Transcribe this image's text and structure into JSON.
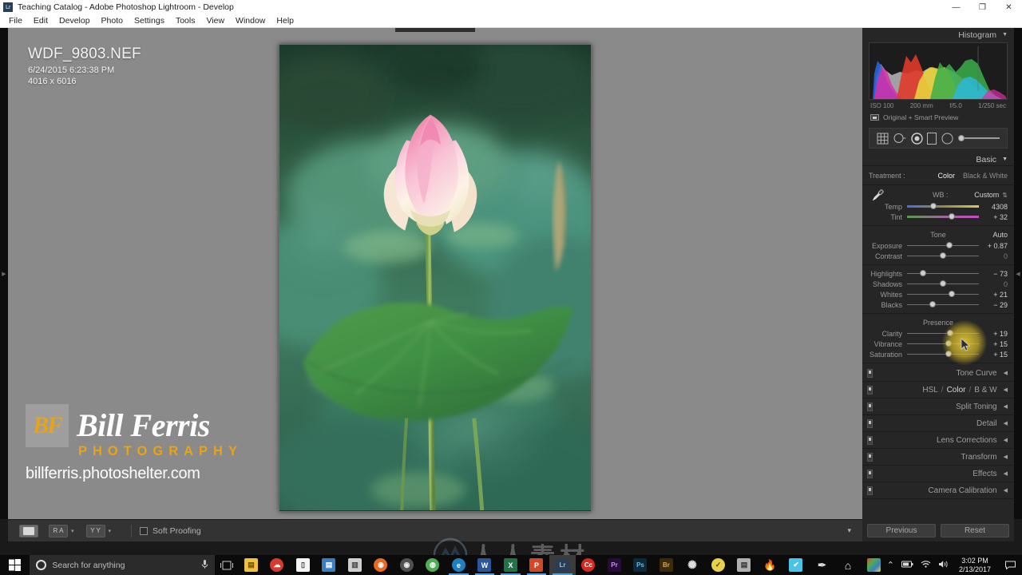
{
  "window": {
    "app_badge": "Lr",
    "title": "Teaching Catalog - Adobe Photoshop Lightroom - Develop",
    "minimize": "—",
    "maximize": "❐",
    "close": "✕"
  },
  "menubar": {
    "items": [
      "File",
      "Edit",
      "Develop",
      "Photo",
      "Settings",
      "Tools",
      "View",
      "Window",
      "Help"
    ]
  },
  "photo_info": {
    "filename": "WDF_9803.NEF",
    "capture_datetime": "6/24/2015 6:23:38 PM",
    "dimensions": "4016 x 6016"
  },
  "watermark": {
    "monogram": "BF",
    "name": "Bill Ferris",
    "tagline": "PHOTOGRAPHY",
    "url": "billferris.photoshelter.com",
    "gold": "#e8a317"
  },
  "toolbar": {
    "view_loupe": "▭",
    "view_compare": "R A",
    "view_survey": "Y Y",
    "soft_proofing_label": "Soft Proofing",
    "expand_caret": "▾"
  },
  "right_panel": {
    "histogram": {
      "title": "Histogram",
      "collapse": "▼",
      "iso": "ISO 100",
      "focal_length": "200 mm",
      "aperture": "f/5.0",
      "shutter": "1/250 sec",
      "preview_status": "Original + Smart Preview"
    },
    "tools": [
      "crop-overlay",
      "spot-removal",
      "red-eye",
      "graduated-filter",
      "radial-filter",
      "adjustment-brush"
    ],
    "basic": {
      "title": "Basic",
      "collapse": "▼",
      "treatment_label": "Treatment :",
      "treatment_color": "Color",
      "treatment_bw": "Black & White",
      "wb_label": "WB :",
      "wb_value": "Custom",
      "wb_dropdown": "⇅",
      "white_balance": [
        {
          "label": "Temp",
          "value": "4308",
          "pos": 37
        },
        {
          "label": "Tint",
          "value": "+ 32",
          "pos": 62
        }
      ],
      "tone_title": "Tone",
      "auto_label": "Auto",
      "tone": [
        {
          "label": "Exposure",
          "value": "+ 0.87",
          "pos": 59,
          "zero": false
        },
        {
          "label": "Contrast",
          "value": "0",
          "pos": 50,
          "zero": true
        }
      ],
      "tone2": [
        {
          "label": "Highlights",
          "value": "− 73",
          "pos": 22,
          "zero": false
        },
        {
          "label": "Shadows",
          "value": "0",
          "pos": 50,
          "zero": true
        },
        {
          "label": "Whites",
          "value": "+ 21",
          "pos": 62,
          "zero": false
        },
        {
          "label": "Blacks",
          "value": "− 29",
          "pos": 36,
          "zero": false
        }
      ],
      "presence_title": "Presence",
      "presence": [
        {
          "label": "Clarity",
          "value": "+ 19",
          "pos": 60,
          "zero": false
        },
        {
          "label": "Vibrance",
          "value": "+ 15",
          "pos": 58,
          "zero": false
        },
        {
          "label": "Saturation",
          "value": "+ 15",
          "pos": 58,
          "zero": false
        }
      ]
    },
    "panels": [
      {
        "label": "Tone Curve",
        "tri": "◀"
      },
      {
        "label": "HSL",
        "label2": "Color",
        "label3": "B & W",
        "sep": "/",
        "tri": "◀"
      },
      {
        "label": "Split Toning",
        "tri": "◀"
      },
      {
        "label": "Detail",
        "tri": "◀"
      },
      {
        "label": "Lens Corrections",
        "tri": "◀"
      },
      {
        "label": "Transform",
        "tri": "◀"
      },
      {
        "label": "Effects",
        "tri": "◀"
      },
      {
        "label": "Camera Calibration",
        "tri": "◀"
      }
    ],
    "footer": {
      "previous": "Previous",
      "reset": "Reset"
    }
  },
  "overlay_watermark": {
    "text": "人人素材"
  },
  "taskbar": {
    "search_placeholder": "Search for anything",
    "mic_icon": "🎤",
    "apps": [
      {
        "name": "file-explorer",
        "glyph": "📁",
        "bg": "#f0c040",
        "color": "#6b4c00"
      },
      {
        "name": "cloud-app",
        "glyph": "☁",
        "bg": "#d63b2f",
        "color": "#fff"
      },
      {
        "name": "store-app",
        "glyph": "🛍",
        "bg": "#f5f5f5",
        "color": "#333"
      },
      {
        "name": "display-app",
        "glyph": "🖥",
        "bg": "#3a7fc1",
        "color": "#fff"
      },
      {
        "name": "recycle-bin",
        "glyph": "🗑",
        "bg": "#cfcfcf",
        "color": "#444"
      },
      {
        "name": "firefox",
        "glyph": "🦊",
        "bg": "#e86a1e",
        "color": "#fff"
      },
      {
        "name": "camera-app",
        "glyph": "◉",
        "bg": "#505050",
        "color": "#eee"
      },
      {
        "name": "chrome",
        "glyph": "◍",
        "bg": "#4caf50",
        "color": "#fff"
      },
      {
        "name": "edge",
        "glyph": "e",
        "bg": "#1e7fc1",
        "color": "#fff"
      },
      {
        "name": "word",
        "glyph": "W",
        "bg": "#2b579a",
        "color": "#fff"
      },
      {
        "name": "excel",
        "glyph": "X",
        "bg": "#217346",
        "color": "#fff"
      },
      {
        "name": "powerpoint",
        "glyph": "P",
        "bg": "#d24726",
        "color": "#fff"
      },
      {
        "name": "lightroom",
        "glyph": "Lr",
        "bg": "#2a3d52",
        "color": "#8fc1e3"
      },
      {
        "name": "adobe-cc",
        "glyph": "Cc",
        "bg": "#d42b1e",
        "color": "#fff"
      },
      {
        "name": "premiere",
        "glyph": "Pr",
        "bg": "#2a0a3d",
        "color": "#c39bd8"
      },
      {
        "name": "photoshop",
        "glyph": "Ps",
        "bg": "#0a2a3d",
        "color": "#6fb8e0"
      },
      {
        "name": "bridge",
        "glyph": "Br",
        "bg": "#3d2a0a",
        "color": "#d8a95a"
      },
      {
        "name": "spiral-app",
        "glyph": "✺",
        "bg": "#4a4a4a",
        "color": "#ddd"
      },
      {
        "name": "clock-app",
        "glyph": "✓",
        "bg": "#e8d04a",
        "color": "#4a3a00"
      },
      {
        "name": "screen-app",
        "glyph": "▤",
        "bg": "#b0b0b0",
        "color": "#333"
      },
      {
        "name": "flame-app",
        "glyph": "🔥",
        "bg": "#c0392b",
        "color": "#fff"
      },
      {
        "name": "blue-check-app",
        "glyph": "✔",
        "bg": "#4ac3e8",
        "color": "#fff"
      },
      {
        "name": "pen-app",
        "glyph": "✒",
        "bg": "#7a7a7a",
        "color": "#fff"
      },
      {
        "name": "home-app",
        "glyph": "⌂",
        "bg": "#f0f0f0",
        "color": "#333"
      },
      {
        "name": "colorwheel-app",
        "glyph": "◕",
        "bg": "#5aa832",
        "color": "#fff"
      }
    ],
    "tray": {
      "chevron": "⌃",
      "battery": "▭",
      "network": "◥",
      "volume": "🔊"
    },
    "clock": {
      "time": "3:02 PM",
      "date": "2/13/2017"
    }
  }
}
